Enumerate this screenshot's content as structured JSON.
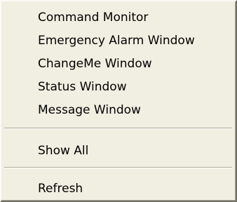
{
  "menu": {
    "items": [
      {
        "label": "Command Monitor"
      },
      {
        "label": "Emergency Alarm Window"
      },
      {
        "label": "ChangeMe Window"
      },
      {
        "label": "Status Window"
      },
      {
        "label": "Message Window"
      },
      {
        "label": "Show All"
      },
      {
        "label": "Refresh"
      }
    ]
  },
  "colors": {
    "menu_background": "#f1efe2",
    "separator": "#aca899",
    "text": "#000000"
  }
}
